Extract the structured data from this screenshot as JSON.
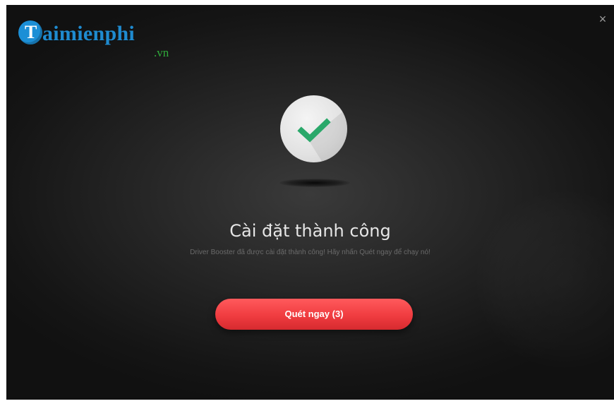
{
  "window": {
    "close_glyph": "×"
  },
  "logo": {
    "mark_letter": "T",
    "text": "aimienphi",
    "domain": ".vn",
    "mark_color": "#1c8fd6",
    "text_color": "#1f8bd0",
    "domain_color": "#2faa3a"
  },
  "status": {
    "icon": "checkmark-icon",
    "check_color": "#2aa86a",
    "title": "Cài đặt thành công",
    "subtitle": "Driver Booster đã được cài đặt thành công! Hãy nhấn Quét ngay để chạy nó!"
  },
  "actions": {
    "scan_label": "Quét ngay (3)",
    "scan_color": "#f03c40"
  }
}
